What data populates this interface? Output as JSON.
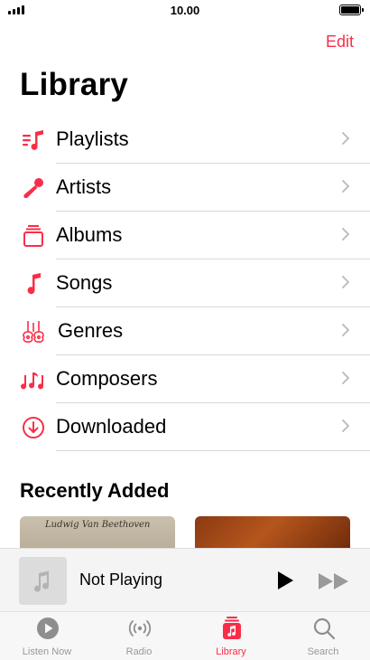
{
  "status_bar": {
    "time": "10.00"
  },
  "nav": {
    "edit_label": "Edit",
    "title": "Library"
  },
  "library_items": [
    {
      "label": "Playlists",
      "icon": "playlists-icon"
    },
    {
      "label": "Artists",
      "icon": "microphone-icon"
    },
    {
      "label": "Albums",
      "icon": "album-stack-icon"
    },
    {
      "label": "Songs",
      "icon": "music-note-icon"
    },
    {
      "label": "Genres",
      "icon": "guitars-icon"
    },
    {
      "label": "Composers",
      "icon": "music-notes-icon"
    },
    {
      "label": "Downloaded",
      "icon": "download-circle-icon"
    }
  ],
  "recently_added": {
    "title": "Recently Added",
    "albums": [
      {
        "cover_text": "Ludwig Van Beethoven"
      }
    ]
  },
  "mini_player": {
    "title": "Not Playing"
  },
  "tab_bar": {
    "tabs": [
      {
        "label": "Listen Now",
        "icon": "play-circle-icon",
        "active": false
      },
      {
        "label": "Radio",
        "icon": "radio-waves-icon",
        "active": false
      },
      {
        "label": "Library",
        "icon": "library-icon",
        "active": true
      },
      {
        "label": "Search",
        "icon": "magnifier-icon",
        "active": false
      }
    ]
  },
  "colors": {
    "accent": "#fa2d48",
    "inactive": "#999999"
  }
}
